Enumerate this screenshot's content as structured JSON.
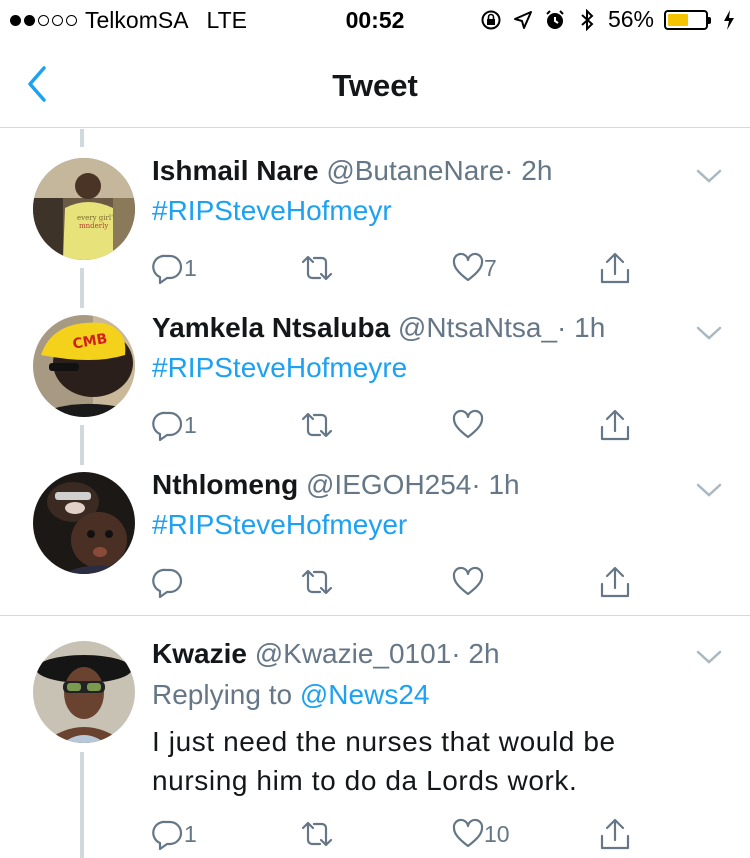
{
  "status_bar": {
    "carrier": "TelkomSA",
    "network": "LTE",
    "time": "00:52",
    "battery": "56%",
    "battery_level": 0.56,
    "battery_color": "#f5c400"
  },
  "nav": {
    "title": "Tweet",
    "back_icon": "chevron-left-icon"
  },
  "colors": {
    "link": "#1da1f2",
    "secondary": "#657786",
    "text": "#14171a"
  },
  "tweets": [
    {
      "name": "Ishmail Nare",
      "handle": "@ButaneNare",
      "time": "· 2h",
      "text": "#RIPSteveHofmeyr",
      "replies": "1",
      "likes": "7"
    },
    {
      "name": "Yamkela Ntsaluba",
      "handle": "@NtsaNtsa_",
      "time": "· 1h",
      "text": "#RIPSteveHofmeyre",
      "replies": "1",
      "likes": ""
    },
    {
      "name": "Nthlomeng",
      "handle": "@IEGOH254",
      "time": "· 1h",
      "text": "#RIPSteveHofmeyer",
      "replies": "",
      "likes": ""
    },
    {
      "name": "Kwazie",
      "handle": "@Kwazie_0101",
      "time": "· 2h",
      "replying_label": "Replying to",
      "replying_to": "@News24",
      "text_line1": "I just need the nurses that would be",
      "text_line2": "nursing him to do da Lords work.",
      "replies": "1",
      "likes": "10"
    }
  ]
}
